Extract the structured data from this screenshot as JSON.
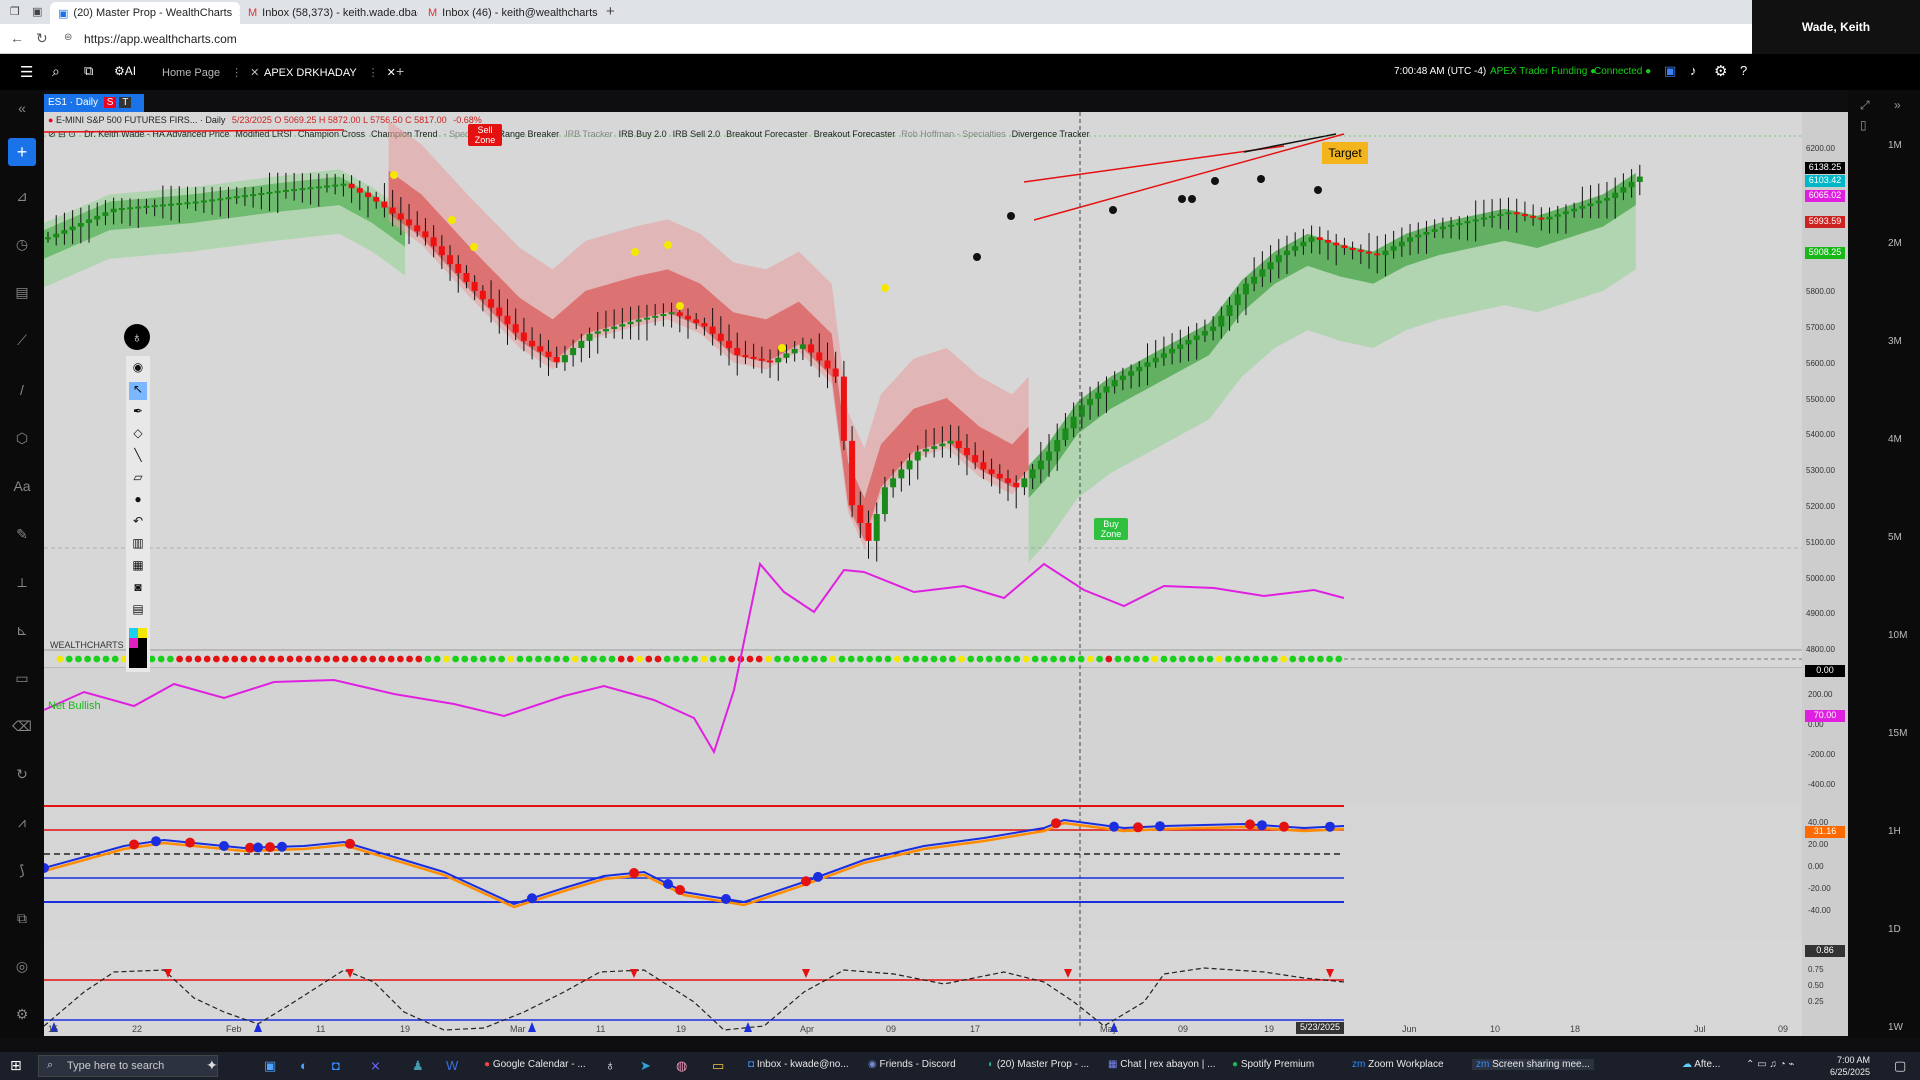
{
  "browser": {
    "tabs": [
      {
        "label": "(20) Master Prop - WealthCharts",
        "active": true
      },
      {
        "label": "Inbox (58,373) - keith.wade.dba@",
        "active": false
      },
      {
        "label": "Inbox (46) - keith@wealthcharts.c",
        "active": false
      }
    ],
    "new_tab": "+",
    "url": "https://app.wealthcharts.com",
    "user": "Wade, Keith"
  },
  "app_header": {
    "tabs": [
      {
        "label": "Home Page",
        "active": false
      },
      {
        "label": "APEX DRKHADAY",
        "active": true
      }
    ],
    "add": "+",
    "time": "7:00:48 AM  (UTC -4)",
    "funding": "APEX Trader Funding",
    "status": "Connected",
    "ai_label": "AI"
  },
  "chart_tab": {
    "label": "ES1 · Daily",
    "tag1": "S",
    "tag2": "T"
  },
  "symbol_line": {
    "name": "E-MINI S&P 500 FUTURES FIRS... · Daily",
    "ohlc": "5/23/2025 O 5069.25 H 5872.00 L 5756.50 C 5817.00",
    "change": "-0.68%"
  },
  "indicators": [
    "Dr. Keith Wade - HA Advanced Price",
    "Modified LRSI",
    "Champion Cross",
    "Champion Trend",
    "- Specialties",
    "Range Breaker",
    "IRB Tracker",
    "IRB Buy 2.0",
    "IRB Sell 2.0",
    "Breakout Forecaster",
    "Breakout Forecaster",
    "Rob Hoffman - Specialties",
    "Divergence Tracker"
  ],
  "annotations": {
    "sell_zone": "Sell Zone",
    "buy_zone": "Buy Zone",
    "target": "Target",
    "net_bullish": "Net Bullish"
  },
  "price_axis": [
    "6200.00",
    "6100.00",
    "6000.00",
    "5900.00",
    "5800.00",
    "5700.00",
    "5600.00",
    "5500.00",
    "5400.00",
    "5300.00",
    "5200.00",
    "5100.00",
    "5000.00",
    "4900.00",
    "4800.00"
  ],
  "price_tags": [
    {
      "v": "6138.25",
      "bg": "#000000"
    },
    {
      "v": "6103.42",
      "bg": "#00b7c7"
    },
    {
      "v": "6065.02",
      "bg": "#e020e0"
    },
    {
      "v": "5993.59",
      "bg": "#cc2222"
    },
    {
      "v": "5908.25",
      "bg": "#19b819"
    }
  ],
  "pane2": {
    "tag": "0.00"
  },
  "pane3": {
    "axis": [
      "200.00",
      "0.00",
      "-200.00",
      "-400.00"
    ],
    "tag": "70.00"
  },
  "pane4": {
    "axis": [
      "40.00",
      "20.00",
      "0.00",
      "-20.00",
      "-40.00"
    ],
    "tag": "31.16"
  },
  "pane5": {
    "axis": [
      "0.75",
      "0.50",
      "0.25"
    ],
    "tag": "0.86"
  },
  "time_axis": [
    "15",
    "22",
    "Feb",
    "11",
    "19",
    "Mar",
    "11",
    "19",
    "Apr",
    "09",
    "17",
    "May",
    "09",
    "19",
    "Jun",
    "10",
    "18",
    "Jul",
    "09"
  ],
  "cursor_date": "5/23/2025",
  "right_scale": [
    "1M",
    "2M",
    "3M",
    "4M",
    "5M",
    "10M",
    "15M",
    "1H",
    "1D",
    "1W"
  ],
  "logo": "WEALTHCHARTS",
  "taskbar": {
    "search": "Type here to search",
    "items": [
      "Google Calendar - ...",
      "Inbox - kwade@no...",
      "Friends - Discord",
      "(20) Master Prop - ...",
      "Chat | rex abayon | ...",
      "Spotify Premium",
      "Zoom Workplace",
      "Screen sharing mee..."
    ],
    "weather": "Afte...",
    "clock_time": "7:00 AM",
    "clock_date": "6/25/2025"
  },
  "colors": {
    "bull": "#1a8a1a",
    "bear": "#ee1111",
    "accent": "#1a73e8"
  }
}
